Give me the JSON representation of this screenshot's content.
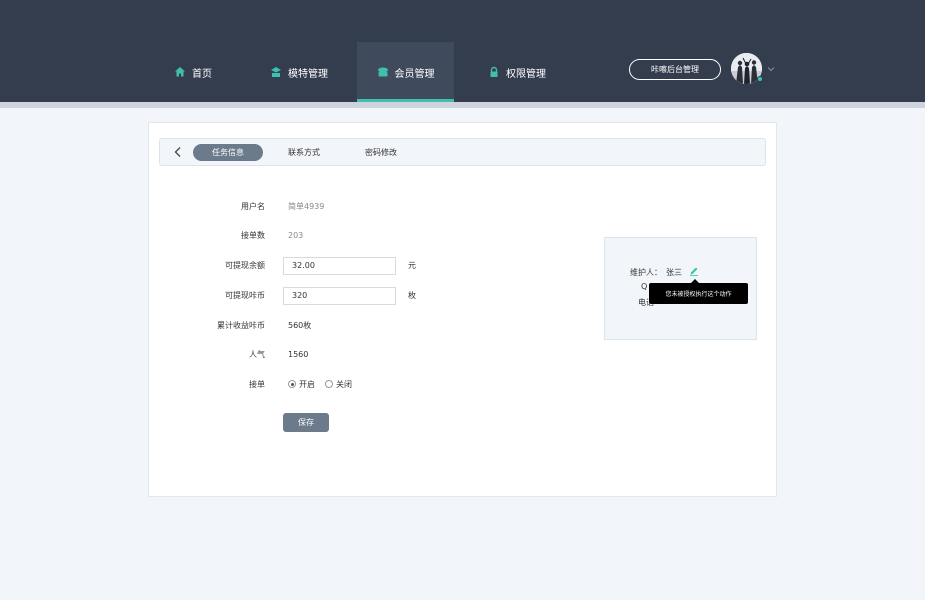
{
  "nav": {
    "items": [
      {
        "label": "首页",
        "icon": "home-icon"
      },
      {
        "label": "模特管理",
        "icon": "model-icon"
      },
      {
        "label": "会员管理",
        "icon": "member-icon",
        "active": true
      },
      {
        "label": "权限管理",
        "icon": "lock-icon"
      }
    ],
    "admin_button": "咔嚓后台管理"
  },
  "tabs": [
    {
      "label": "任务信息",
      "active": true
    },
    {
      "label": "联系方式"
    },
    {
      "label": "密码修改"
    }
  ],
  "form": {
    "username_label": "用户名",
    "username_value": "简单4939",
    "orders_label": "接单数",
    "orders_value": "203",
    "balance_label": "可提现余额",
    "balance_value": "32.00",
    "balance_unit": "元",
    "coins_label": "可提现咔币",
    "coins_value": "320",
    "coins_unit": "枚",
    "total_coins_label": "累计收益咔币",
    "total_coins_value": "560枚",
    "popularity_label": "人气",
    "popularity_value": "1560",
    "accept_label": "接单",
    "accept_on": "开启",
    "accept_off": "关闭",
    "save_button": "保存"
  },
  "side_panel": {
    "maintainer_label": "维护人：",
    "maintainer_value": "张三",
    "qq_label_partial": "Q",
    "phone_label_partial": "电话",
    "tooltip": "您未被授权执行这个动作"
  },
  "colors": {
    "topbar": "#343d4e",
    "accent": "#3fbfae",
    "button": "#6b7b8c"
  }
}
